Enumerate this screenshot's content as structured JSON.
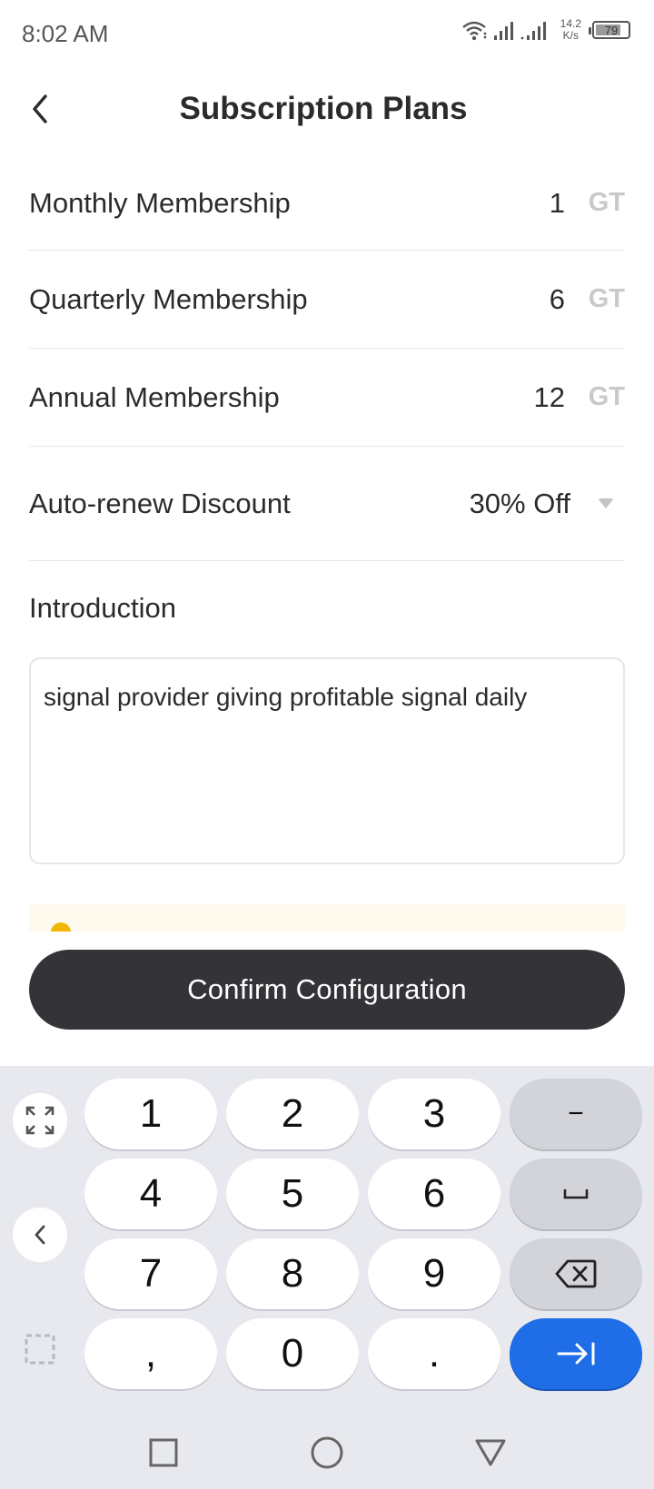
{
  "status_bar": {
    "time": "8:02 AM",
    "net_speed_value": "14.2",
    "net_speed_unit": "K/s",
    "battery": "79",
    "battery_level": 0.79
  },
  "header": {
    "title": "Subscription Plans",
    "back_icon": "chevron-left-icon"
  },
  "plans": [
    {
      "label": "Monthly Membership",
      "value": "1",
      "unit": "GT"
    },
    {
      "label": "Quarterly Membership",
      "value": "6",
      "unit": "GT"
    },
    {
      "label": "Annual Membership",
      "value": "12",
      "unit": "GT"
    }
  ],
  "discount": {
    "label": "Auto-renew Discount",
    "value": "30% Off"
  },
  "introduction": {
    "label": "Introduction",
    "text": "signal provider giving profitable signal daily"
  },
  "confirm_label": "Confirm Configuration",
  "keyboard": {
    "keys": [
      "1",
      "2",
      "3",
      "−",
      "4",
      "5",
      "6",
      "␣",
      "7",
      "8",
      "9",
      "backspace",
      "，",
      "0",
      ".",
      "enter"
    ],
    "row1": [
      "1",
      "2",
      "3"
    ],
    "row2": [
      "4",
      "5",
      "6"
    ],
    "row3": [
      "7",
      "8",
      "9"
    ],
    "row4": [
      ",",
      "0",
      "."
    ],
    "minus": "−",
    "accent_color": "#1f6ee8"
  },
  "colors": {
    "button_dark": "#333338",
    "unit_gray": "#c9c9cc",
    "notice_bg": "#fffaee"
  }
}
